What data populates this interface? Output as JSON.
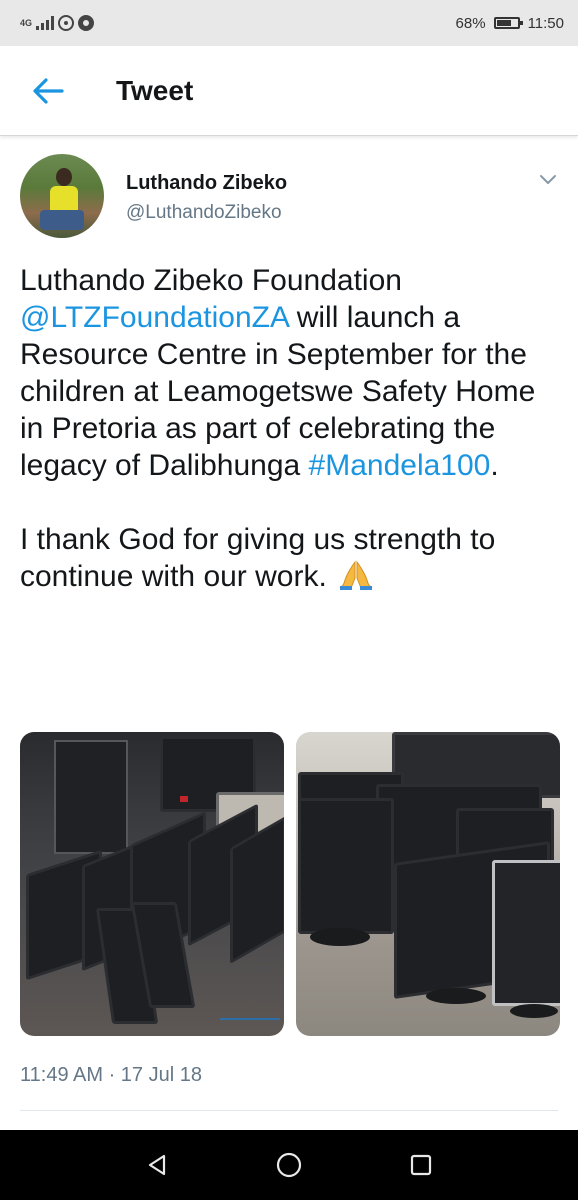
{
  "status_bar": {
    "network": "4G",
    "battery": "68%",
    "battery_level": 0.68,
    "time": "11:50"
  },
  "header": {
    "title": "Tweet"
  },
  "tweet": {
    "author_name": "Luthando Zibeko",
    "author_handle": "@LuthandoZibeko",
    "text_part1": "Luthando Zibeko Foundation ",
    "mention": "@LTZFoundationZA",
    "text_part2": " will launch a Resource Centre in September for the children at Leamogetswe Safety Home in Pretoria as part of celebrating the legacy of Dalibhunga ",
    "hashtag": "#Mandela100",
    "text_part3": ".",
    "text_paragraph2": "I thank God for giving us strength to continue with our work. ",
    "emoji": "folded-hands",
    "timestamp": "11:49 AM · 17 Jul 18"
  },
  "colors": {
    "link": "#1b95e0",
    "text": "#14171a",
    "secondary": "#657786",
    "status_bar_bg": "#e8e8e8",
    "nav_bar_bg": "#000000"
  },
  "icons": {
    "back": "arrow-left-icon",
    "caret": "chevron-down-icon",
    "nav_back": "triangle-back-icon",
    "nav_home": "circle-home-icon",
    "nav_recents": "square-recents-icon"
  }
}
